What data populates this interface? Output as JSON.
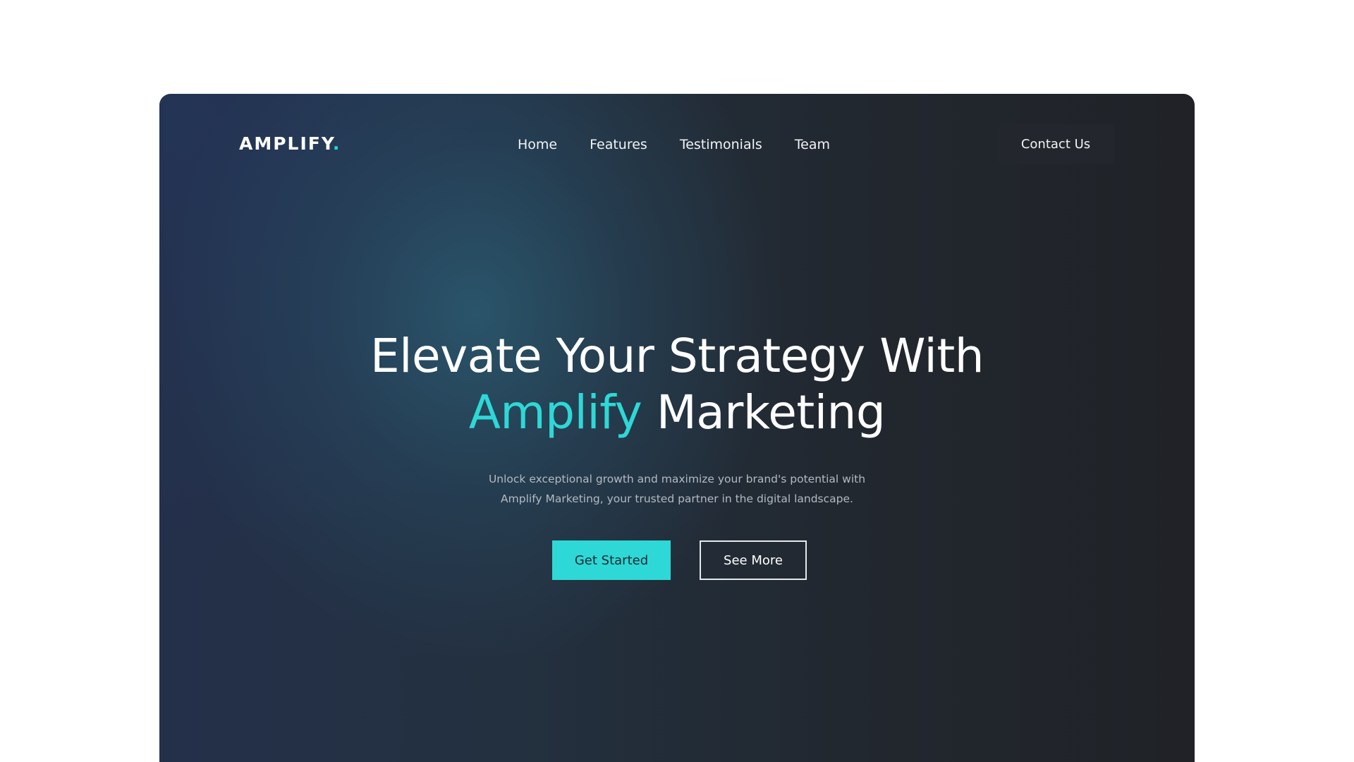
{
  "brand": {
    "name": "AMPLIFY",
    "dot": "."
  },
  "nav": {
    "items": [
      {
        "label": "Home"
      },
      {
        "label": "Features"
      },
      {
        "label": "Testimonials"
      },
      {
        "label": "Team"
      }
    ],
    "contact_label": "Contact Us"
  },
  "hero": {
    "title_line1": "Elevate Your Strategy With",
    "title_accent": "Amplify",
    "title_rest": " Marketing",
    "subtitle_line1": "Unlock exceptional growth and maximize your brand's potential with",
    "subtitle_line2": "Amplify Marketing, your trusted partner in the digital landscape.",
    "primary_label": "Get Started",
    "secondary_label": "See More"
  },
  "colors": {
    "accent": "#2ed8d6",
    "background_dark": "#202227",
    "background_blue": "#2a4a62",
    "text_light": "#ffffff",
    "text_muted": "#b3bac2"
  }
}
